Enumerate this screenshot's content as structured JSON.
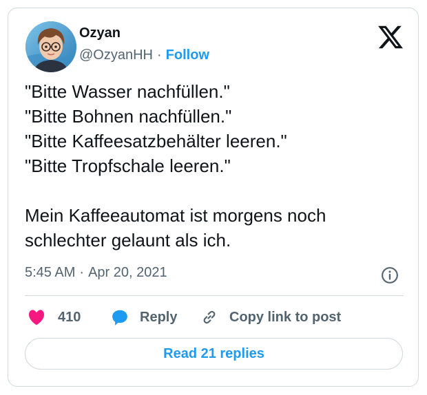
{
  "author": {
    "name": "Ozyan",
    "handle": "@OzyanHH",
    "separator": "·",
    "follow_label": "Follow",
    "avatar_icon": "cartoon-avatar-with-glasses"
  },
  "platform_icon": "x-logo-icon",
  "tweet": {
    "text": "\"Bitte Wasser nachfüllen.\"\n\"Bitte Bohnen nachfüllen.\"\n\"Bitte Kaffeesatzbehälter leeren.\"\n\"Bitte Tropfschale leeren.\"\n\nMein Kaffeeautomat ist morgens noch schlechter gelaunt als ich.",
    "time": "5:45 AM",
    "separator": "·",
    "date": "Apr 20, 2021"
  },
  "actions": {
    "like_count": "410",
    "reply_label": "Reply",
    "copy_label": "Copy link to post"
  },
  "read_replies_label": "Read 21 replies",
  "colors": {
    "accent": "#1d9bf0",
    "like": "#f91880",
    "text": "#0f1419",
    "secondary": "#536471",
    "border": "#cfd9de"
  }
}
